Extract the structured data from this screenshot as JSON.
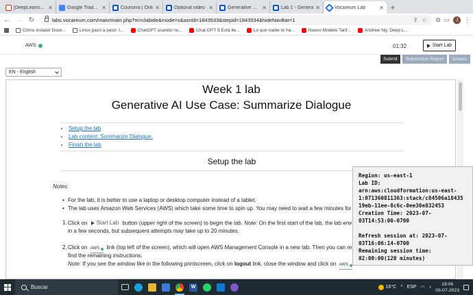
{
  "browser": {
    "tabs": [
      {
        "label": "[DeepLearning.",
        "favicon": "gmail-icon",
        "active": false
      },
      {
        "label": "Google Traducto",
        "favicon": "google-translate-icon",
        "active": false
      },
      {
        "label": "Coursera | Onli",
        "favicon": "coursera-icon",
        "active": false
      },
      {
        "label": "Optional video",
        "favicon": "coursera-icon",
        "active": false
      },
      {
        "label": "Generative AI w",
        "favicon": "coursera-icon",
        "active": false
      },
      {
        "label": "Lab 1 - Genera",
        "favicon": "coursera-icon",
        "active": false
      },
      {
        "label": "Vocareum Lab",
        "favicon": "vocareum-icon",
        "active": true
      }
    ],
    "new_tab": "+",
    "url": "labs.vocareum.com/main/main.php?m=clabide&mode=s&asnid=1843533&stepid=1843534&hideNavBar=1",
    "profile_initial": "J",
    "bookmarks": [
      {
        "label": "Cómo instalar Dock...",
        "icon": "page-icon"
      },
      {
        "label": "Linux paso a paso: I...",
        "icon": "page-icon"
      },
      {
        "label": "ChatGPT usando nu...",
        "icon": "youtube-icon"
      },
      {
        "label": "Chat GPT 5 Está lle...",
        "icon": "youtube-icon"
      },
      {
        "label": "Lo que nadie te ha...",
        "icon": "youtube-icon"
      },
      {
        "label": "Nuevo Modelo Tarif...",
        "icon": "youtube-icon"
      },
      {
        "label": "Andrew Ng: Deep L...",
        "icon": "youtube-icon"
      }
    ]
  },
  "lab_header": {
    "aws_label": "AWS",
    "aws_status_color": "#3cb371",
    "timer": "01:32",
    "start_lab": "Start Lab"
  },
  "actions": {
    "submit": "Submit",
    "submission_report": "Submission Report",
    "grades": "Grades"
  },
  "language": {
    "selected": "EN - English"
  },
  "document": {
    "week": "Week 1 lab",
    "title": "Generative AI Use Case: Summarize Dialogue",
    "toc": [
      "Setup the lab",
      "Lab content: Summarize Dialogue.",
      "Finish the lab"
    ],
    "section_setup": "Setup the lab",
    "notes_label": "Notes:",
    "bullet_1": "For the lab, it is better to use a laptop or desktop computer instead of a tablet.",
    "bullet_2": "The lab uses Amazon Web Services (AWS) which take some time to spin up. You may need to wait a few minutes for",
    "step1_a": "Click on",
    "step1_btn": "Start Lab",
    "step1_b": "button (upper right of the screen) to begin the lab.",
    "step1_note": "Note:",
    "step1_c": "On the first start of the lab, the lab env",
    "step1_d": "in a few seconds, but subsequent attempts may take up to 20 minutes.",
    "step2_a": "Click on",
    "step2_aws": "AWS",
    "step2_b": "link (top left of the screen), which will open AWS Management Console in a new tab. Then you can re",
    "step2_c": "find the remaining instructions.",
    "step2_note": "Note:",
    "step2_d": "If you see the window like in the following printscreen, click on",
    "step2_logout": "logout",
    "step2_e": "link, close the window and click on",
    "step2_aws2": "AWS",
    "step1_num": "1.",
    "step2_num": "2."
  },
  "session_info": {
    "region": "Region: us-east-1",
    "lab_id_label": "Lab ID:",
    "lab_id_1": "arn:aws:cloudformation:us-east-",
    "lab_id_2": "1:071360811363:stack/c84506a18435",
    "lab_id_3": "19eb-11ee-8c6c-0ee30e832453",
    "creation_1": "Creation Time: 2023-07-",
    "creation_2": "03T14:53:00-0700",
    "refresh_1": "Refresh session at: 2023-07-",
    "refresh_2": "03T16:06:14-0700",
    "remaining_1": "Remaining session time:",
    "remaining_2": "02:00:00(120 minutes)"
  },
  "taskbar": {
    "search_label": "Buscar",
    "apps": [
      "task-view-icon",
      "edge-icon",
      "file-explorer-icon",
      "store-icon",
      "chrome-icon",
      "word-icon",
      "whatsapp-icon",
      "mail-icon",
      "app-icon"
    ],
    "weather": "16°C",
    "language": "ESP",
    "time": "19:06",
    "date": "03-07-2023"
  }
}
